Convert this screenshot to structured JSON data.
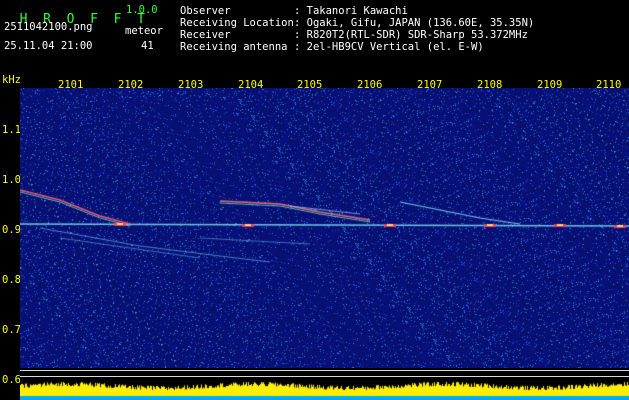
{
  "app": {
    "name_letters": [
      "H",
      "R",
      "O",
      "F",
      "F",
      "T"
    ],
    "version": "1.0.0",
    "filename": "2511042100.png",
    "datetime": "25.11.04 21:00",
    "meteor_label": "meteor",
    "meteor_count": "41"
  },
  "info": {
    "observer_label": "Observer",
    "observer_value": ": Takanori Kawachi",
    "location_label": "Receiving Location",
    "location_value": ": Ogaki, Gifu, JAPAN (136.60E, 35.35N)",
    "receiver_label": "Receiver",
    "receiver_value": ": R820T2(RTL-SDR) SDR-Sharp 53.372MHz",
    "antenna_label": "Receiving antenna",
    "antenna_value": ": 2el-HB9CV Vertical (el. E-W)"
  },
  "axis": {
    "unit": "kHz",
    "x_ticks": [
      "2101",
      "2102",
      "2103",
      "2104",
      "2105",
      "2106",
      "2107",
      "2108",
      "2109",
      "2110"
    ],
    "y_ticks": [
      "1.1",
      "1.0",
      "0.9",
      "0.8",
      "0.7",
      "0.6"
    ]
  },
  "colors": {
    "background": "#000000",
    "noise_base": "#0a1a6e",
    "tick_text": "#ffff00",
    "title": "#33ff33",
    "level_bars": "#ffee00",
    "level_base": "#00aaff"
  }
}
